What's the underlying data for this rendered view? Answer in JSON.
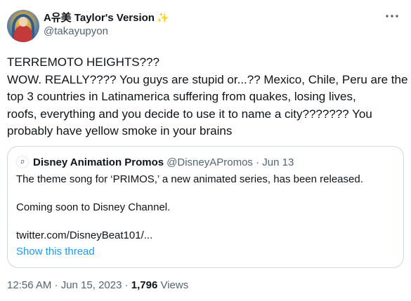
{
  "author": {
    "display_name": "A유美 Taylor's Version",
    "emoji": "✨",
    "handle": "@takayupyon"
  },
  "tweet": {
    "lines": [
      "TERREMOTO HEIGHTS???",
      "WOW. REALLY???? You guys are stupid or...?? Mexico, Chile, Peru are the",
      "top 3 countries in Latinamerica suffering from quakes, losing lives,",
      "roofs, everything and you decide to use it to name a city??????? You",
      "probably have yellow smoke in your brains"
    ]
  },
  "quote": {
    "name": "Disney Animation Promos",
    "meta": "@DisneyAPromos · Jun 13",
    "paragraphs": [
      "The theme song for ‘PRIMOS,’ a new animated series, has been released.",
      "Coming soon to Disney Channel.",
      "twitter.com/DisneyBeat101/..."
    ],
    "show_thread": "Show this thread"
  },
  "footer": {
    "timestamp": "12:56 AM · Jun 15, 2023 · ",
    "views_count": "1,796",
    "views_label": " Views"
  },
  "colors": {
    "text": "#0f1419",
    "muted": "#536471",
    "link": "#1d9bf0",
    "border": "#cfd9de"
  },
  "icons": {
    "more": "more-options-icon"
  }
}
